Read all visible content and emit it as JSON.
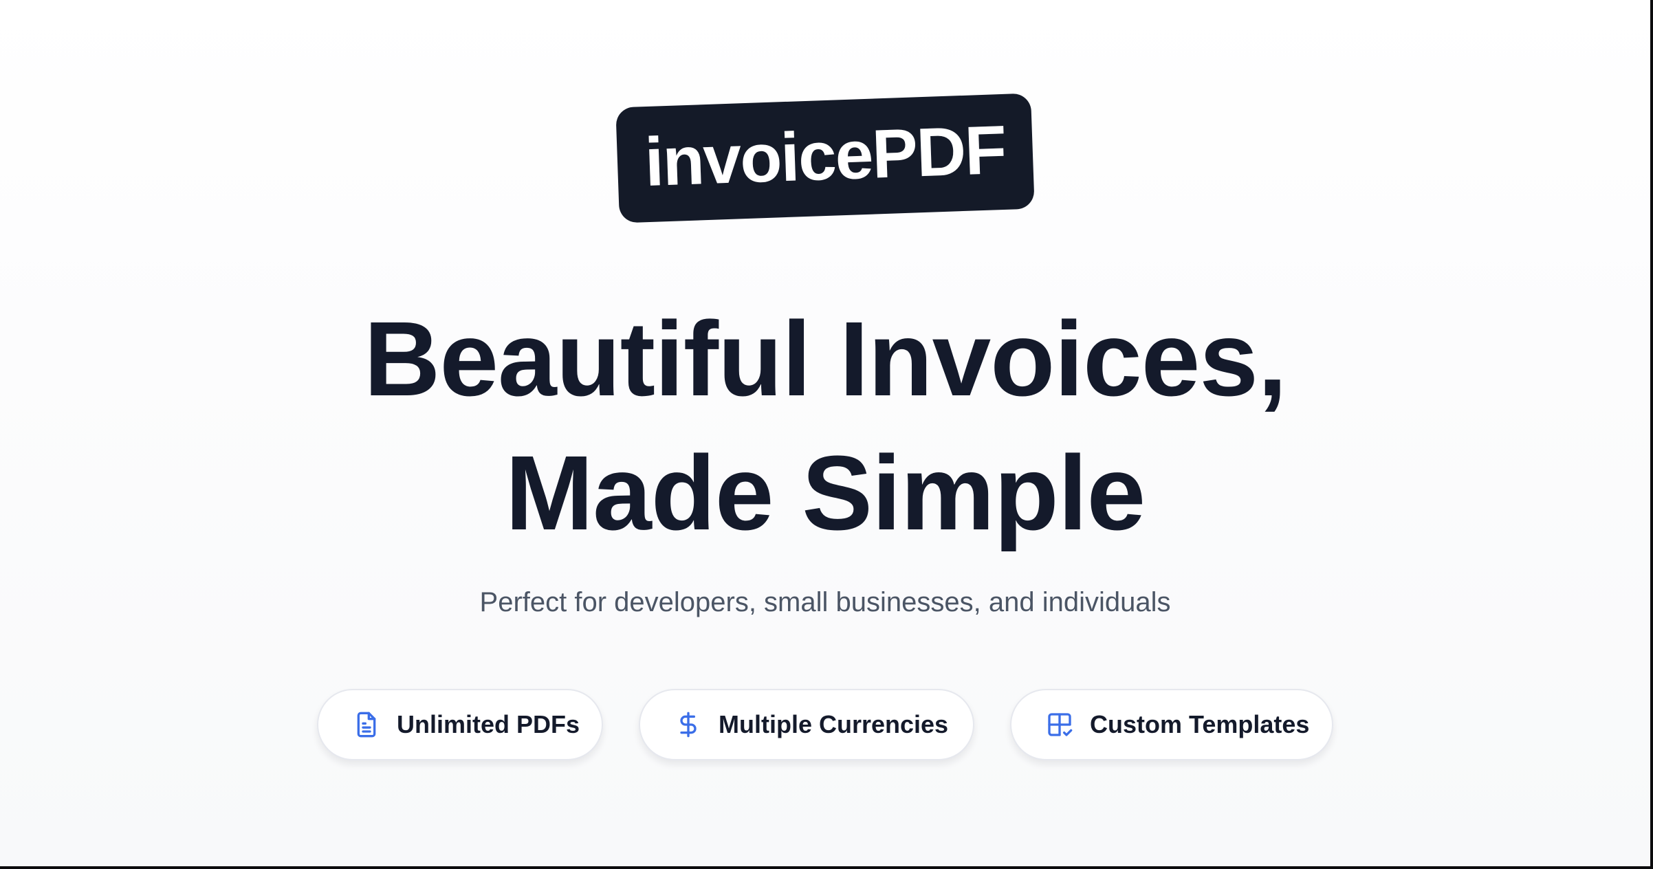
{
  "brand": {
    "logo_text": "invoicePDF",
    "badge_color": "#141a28"
  },
  "hero": {
    "headline_line1": "Beautiful Invoices,",
    "headline_line2": "Made Simple",
    "subtitle": "Perfect for developers, small businesses, and individuals"
  },
  "features": [
    {
      "label": "Unlimited PDFs",
      "icon": "document-icon"
    },
    {
      "label": "Multiple Currencies",
      "icon": "dollar-icon"
    },
    {
      "label": "Custom Templates",
      "icon": "template-check-icon"
    }
  ],
  "colors": {
    "accent": "#3b6ee8",
    "text_primary": "#141a2b",
    "text_secondary": "#4b5565"
  }
}
